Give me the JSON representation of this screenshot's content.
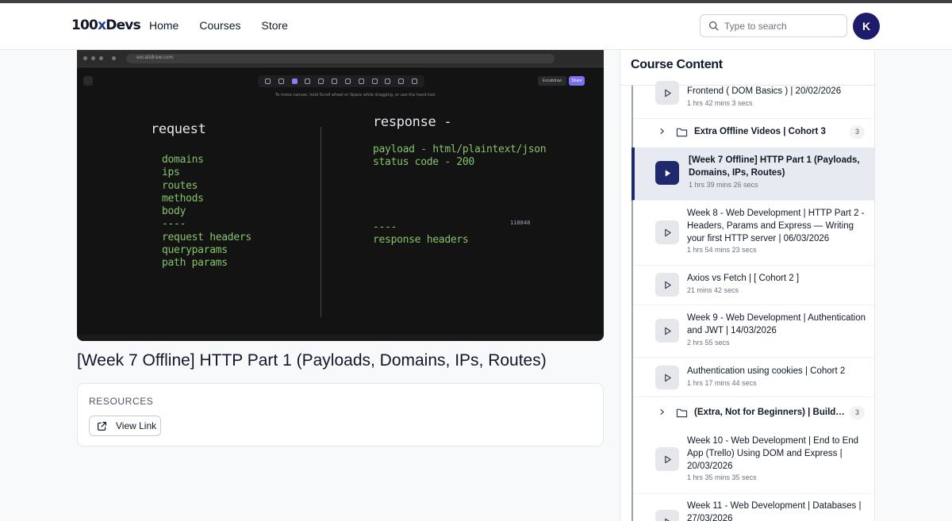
{
  "header": {
    "logo_main": "100",
    "logo_x": "x",
    "logo_tail": "Devs",
    "nav": [
      "Home",
      "Courses",
      "Store"
    ],
    "search_placeholder": "Type to search",
    "avatar_initial": "K"
  },
  "video": {
    "url": "excalidraw.com",
    "toolbar_hint": "To move canvas, hold Scroll wheel or Space while dragging, or use the hand tool",
    "library_label": "Excalidraw",
    "share_label": "Share",
    "board": {
      "left_heading": "request",
      "left_items": [
        "domains",
        "ips",
        "routes",
        "methods",
        "body",
        "----",
        "request headers",
        "queryparams",
        "path params"
      ],
      "right_heading": "response -",
      "right_items": [
        "payload - html/plaintext/json",
        "status code - 200"
      ],
      "right_bottom": [
        "----",
        "response headers"
      ],
      "number": "118848"
    }
  },
  "lesson": {
    "title": "[Week 7 Offline] HTTP Part 1 (Payloads, Domains, IPs, Routes)"
  },
  "resources": {
    "label": "RESOURCES",
    "link_label": "View Link"
  },
  "sidebar": {
    "title": "Course Content",
    "entries": [
      {
        "kind": "video",
        "name": "Frontend ( DOM Basics ) | 20/02/2026",
        "duration": "1 hrs 42 mins 3 secs",
        "active": false
      },
      {
        "kind": "folder",
        "name": "Extra Offline Videos | Cohort 3",
        "count": "3"
      },
      {
        "kind": "video",
        "name": "[Week 7 Offline] HTTP Part 1 (Payloads, Domains, IPs, Routes)",
        "duration": "1 hrs 39 mins 26 secs",
        "active": true
      },
      {
        "kind": "video",
        "name": "Week 8 - Web Development | HTTP Part 2 - Headers, Params and Express — Writing your first HTTP server | 06/03/2026",
        "duration": "1 hrs 54 mins 23 secs",
        "active": false
      },
      {
        "kind": "video",
        "name": "Axios vs Fetch | [ Cohort 2 ]",
        "duration": "21 mins 42 secs",
        "active": false
      },
      {
        "kind": "video",
        "name": "Week 9 - Web Development | Authentication and JWT | 14/03/2026",
        "duration": "2 hrs 55 secs",
        "active": false
      },
      {
        "kind": "video",
        "name": "Authentication using cookies | Cohort 2",
        "duration": "1 hrs 17 mins 44 secs",
        "active": false
      },
      {
        "kind": "folder",
        "name": "(Extra, Not for Beginners) | Building a ...",
        "count": "3"
      },
      {
        "kind": "video",
        "name": "Week 10 - Web Development | End to End App (Trello) Using DOM and Express | 20/03/2026",
        "duration": "1 hrs 35 mins 35 secs",
        "active": false
      },
      {
        "kind": "video",
        "name": "Week 11 - Web Development | Databases | 27/03/2026",
        "duration": "",
        "active": false
      }
    ]
  },
  "colors": {
    "accent": "#1e2a6b",
    "avatar": "#1e1b6b",
    "board_green": "#86c26a"
  }
}
